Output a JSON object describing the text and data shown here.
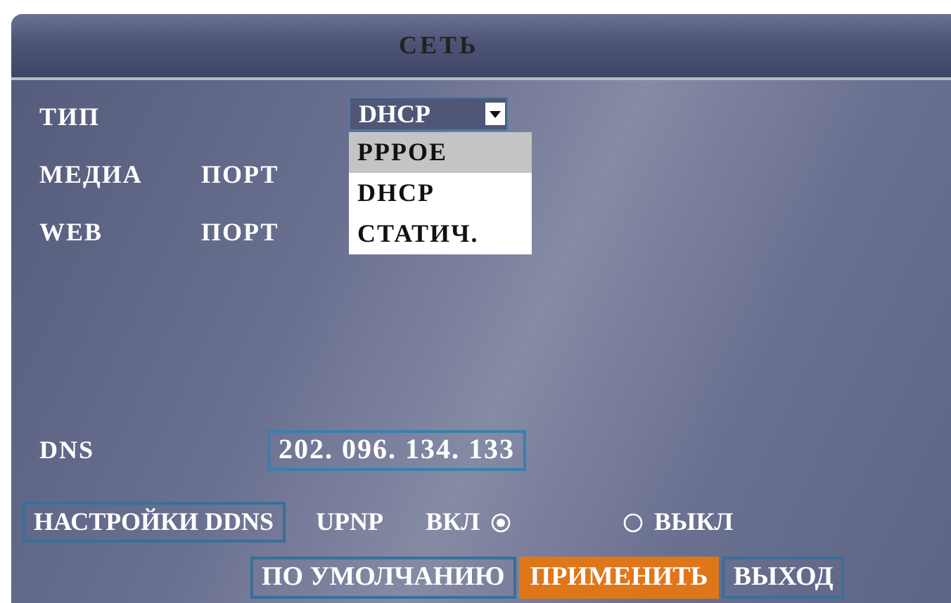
{
  "title": "СЕТЬ",
  "rows": [
    {
      "kind": "dropdown",
      "label": "ТИП",
      "value": "DHCP",
      "expanded": true,
      "options": [
        {
          "label": "PPPOE",
          "highlighted": true
        },
        {
          "label": "DHCP",
          "highlighted": false
        },
        {
          "label": "СТАТИЧ.",
          "highlighted": false
        }
      ]
    },
    {
      "kind": "label",
      "label": "МЕДИА",
      "label_2": "ПОРТ"
    },
    {
      "kind": "label",
      "label": "WEB",
      "label_2": "ПОРТ"
    }
  ],
  "dns": {
    "label": "DNS",
    "value": "202. 096. 134. 133"
  },
  "ddns_button": "НАСТРОЙКИ DDNS",
  "upnp": {
    "label": "UPNP",
    "options": [
      {
        "label": "ВКЛ",
        "selected": true
      },
      {
        "label": "ВЫКЛ",
        "selected": false
      }
    ]
  },
  "buttons": [
    {
      "label": "ПО УМОЛЧАНИЮ",
      "selected": false
    },
    {
      "label": "ПРИМЕНИТЬ",
      "selected": true
    },
    {
      "label": "ВЫХОД",
      "selected": false
    }
  ]
}
